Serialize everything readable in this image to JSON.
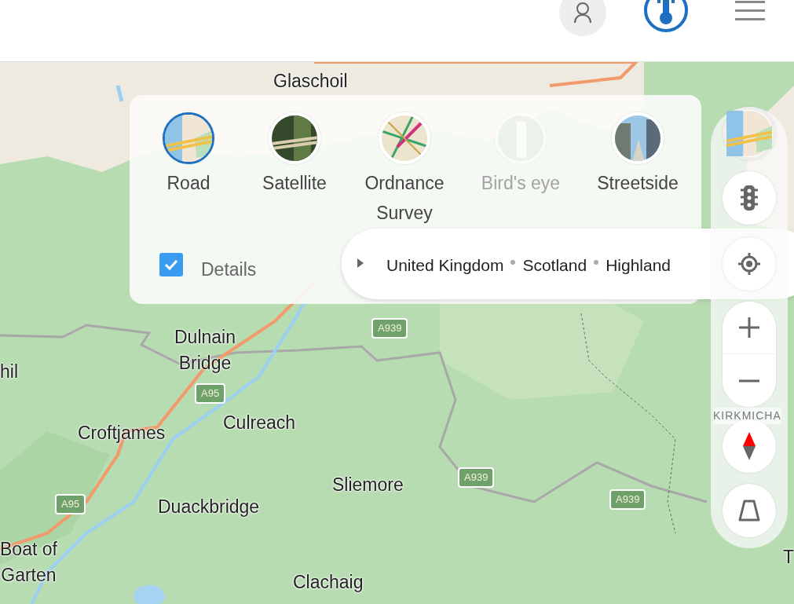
{
  "map_styles": [
    {
      "label": "Road",
      "kind": "road",
      "selected": true,
      "disabled": false
    },
    {
      "label": "Satellite",
      "kind": "satellite",
      "selected": false,
      "disabled": false
    },
    {
      "label": "Ordnance Survey",
      "kind": "ordnance",
      "selected": false,
      "disabled": false
    },
    {
      "label": "Bird's eye",
      "kind": "birdseye",
      "selected": false,
      "disabled": true
    },
    {
      "label": "Streetside",
      "kind": "streetside",
      "selected": false,
      "disabled": false
    }
  ],
  "details": {
    "label": "Details",
    "checked": true
  },
  "breadcrumb": {
    "expanded": false,
    "items": [
      "United Kingdom",
      "Scotland",
      "Highland"
    ]
  },
  "map_labels": [
    {
      "text": "Glaschoil",
      "kind": "place"
    },
    {
      "text": "hil",
      "kind": "place"
    },
    {
      "text": "Dulnain\nBridge",
      "kind": "place"
    },
    {
      "text": "Croftjames",
      "kind": "place"
    },
    {
      "text": "Culreach",
      "kind": "place"
    },
    {
      "text": "Sliemore",
      "kind": "place"
    },
    {
      "text": "Duackbridge",
      "kind": "place"
    },
    {
      "text": "Boat of\nGarten",
      "kind": "place"
    },
    {
      "text": "Clachaig",
      "kind": "place"
    },
    {
      "text": "KIRKMICHA",
      "kind": "area"
    },
    {
      "text": "T",
      "kind": "place"
    },
    {
      "text": "A939",
      "kind": "road"
    },
    {
      "text": "A95",
      "kind": "road"
    },
    {
      "text": "A939",
      "kind": "road"
    },
    {
      "text": "A939",
      "kind": "road"
    },
    {
      "text": "A95",
      "kind": "road"
    }
  ]
}
